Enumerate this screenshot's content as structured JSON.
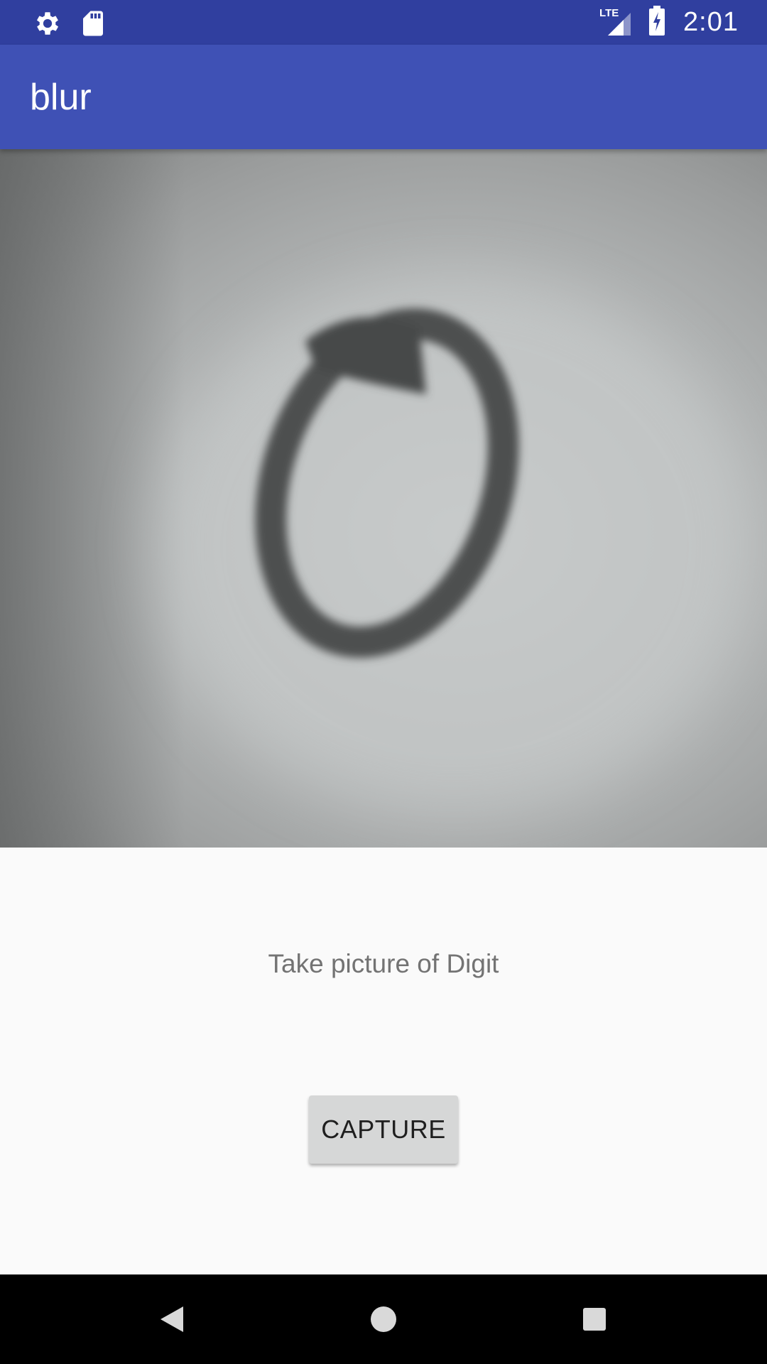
{
  "status_bar": {
    "left_icons": [
      "gear-icon",
      "sd-card-icon"
    ],
    "network_label": "LTE",
    "time": "2:01",
    "colors": {
      "background": "#303f9f"
    }
  },
  "app_bar": {
    "title": "blur",
    "colors": {
      "background": "#3f51b5"
    }
  },
  "camera_preview": {
    "subject": "handwritten digit 0"
  },
  "main": {
    "prompt_text": "Take picture of Digit",
    "capture_label": "CAPTURE"
  },
  "nav_bar": {
    "buttons": [
      "back-icon",
      "home-icon",
      "recents-icon"
    ]
  }
}
